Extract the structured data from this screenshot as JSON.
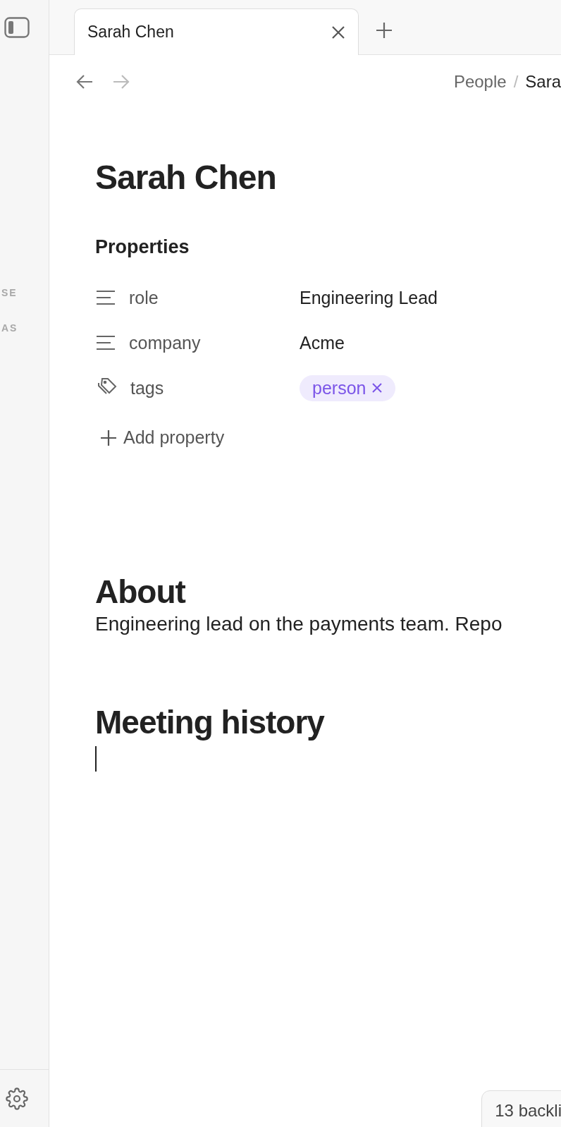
{
  "tabs": [
    {
      "label": "Sarah Chen",
      "selected": true
    }
  ],
  "breadcrumb": {
    "items": [
      "People",
      "Sara"
    ],
    "separator": "/"
  },
  "sidebar": {
    "section_labels": [
      "SE",
      "AS"
    ]
  },
  "page": {
    "title": "Sarah Chen",
    "properties_heading": "Properties",
    "properties": [
      {
        "kind": "text",
        "name": "role",
        "value": "Engineering Lead"
      },
      {
        "kind": "text",
        "name": "company",
        "value": "Acme"
      },
      {
        "kind": "tags",
        "name": "tags",
        "tags": [
          "person"
        ]
      }
    ],
    "add_property": "Add property",
    "sections": [
      {
        "heading": "About",
        "body": "Engineering lead on the payments team. Repo"
      },
      {
        "heading": "Meeting history"
      }
    ]
  },
  "backlinks": "13 backli"
}
